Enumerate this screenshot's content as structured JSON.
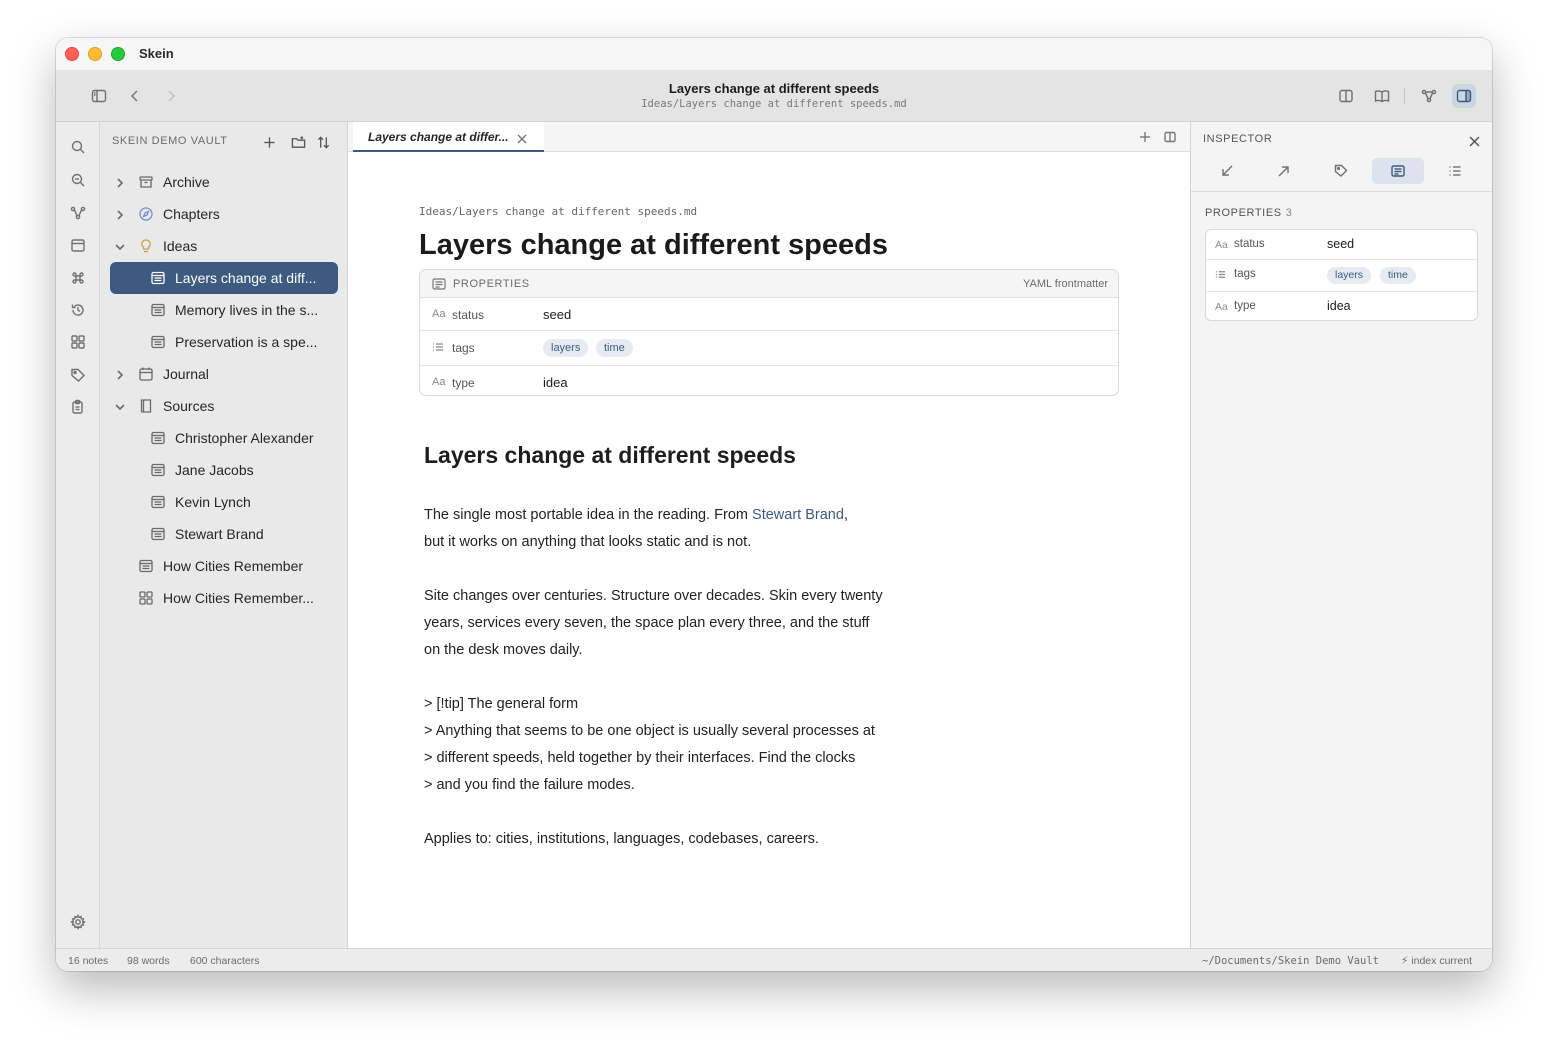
{
  "app": {
    "name": "Skein"
  },
  "toolbar": {
    "title": "Layers change at different speeds",
    "path": "Ideas/Layers change at different speeds.md"
  },
  "sidebar": {
    "vault_name": "SKEIN DEMO VAULT",
    "items": [
      {
        "label": "Archive",
        "icon": "archive-icon",
        "kind": "folder",
        "expanded": false,
        "depth": 0
      },
      {
        "label": "Chapters",
        "icon": "compass-icon",
        "kind": "folder",
        "expanded": false,
        "depth": 0
      },
      {
        "label": "Ideas",
        "icon": "lightbulb-icon",
        "kind": "folder",
        "expanded": true,
        "depth": 0
      },
      {
        "label": "Layers change at diff...",
        "icon": "note-icon",
        "kind": "note",
        "depth": 1,
        "selected": true
      },
      {
        "label": "Memory lives in the s...",
        "icon": "note-icon",
        "kind": "note",
        "depth": 1
      },
      {
        "label": "Preservation is a spe...",
        "icon": "note-icon",
        "kind": "note",
        "depth": 1
      },
      {
        "label": "Journal",
        "icon": "calendar-icon",
        "kind": "folder",
        "expanded": false,
        "depth": 0
      },
      {
        "label": "Sources",
        "icon": "book-icon",
        "kind": "folder",
        "expanded": true,
        "depth": 0
      },
      {
        "label": "Christopher Alexander",
        "icon": "note-icon",
        "kind": "note",
        "depth": 1
      },
      {
        "label": "Jane Jacobs",
        "icon": "note-icon",
        "kind": "note",
        "depth": 1
      },
      {
        "label": "Kevin Lynch",
        "icon": "note-icon",
        "kind": "note",
        "depth": 1
      },
      {
        "label": "Stewart Brand",
        "icon": "note-icon",
        "kind": "note",
        "depth": 1
      },
      {
        "label": "How Cities Remember",
        "icon": "note-icon",
        "kind": "note",
        "depth": 0
      },
      {
        "label": "How Cities Remember...",
        "icon": "grid-icon",
        "kind": "canvas",
        "depth": 0
      }
    ]
  },
  "tab": {
    "label": "Layers change at differ..."
  },
  "editor": {
    "file_path": "Ideas/Layers change at different speeds.md",
    "title": "Layers change at different speeds",
    "properties": {
      "header": "PROPERTIES",
      "source": "YAML frontmatter",
      "rows": [
        {
          "type": "Aa",
          "key": "status",
          "value": "seed"
        },
        {
          "type": "list",
          "key": "tags",
          "chips": [
            "layers",
            "time"
          ]
        },
        {
          "type": "Aa",
          "key": "type",
          "value": "idea"
        }
      ]
    },
    "heading": "Layers change at different speeds",
    "paragraphs": {
      "p1_before": "The single most portable idea in the reading. From ",
      "p1_link": "Stewart Brand",
      "p1_after": ",",
      "p1_line2": "but it works on anything that looks static and is not.",
      "p2_l1": "Site changes over centuries. Structure over decades. Skin every twenty",
      "p2_l2": "years, services every seven, the space plan every three, and the stuff",
      "p2_l3": "on the desk moves daily.",
      "q_l1": "> [!tip] The general form",
      "q_l2": "> Anything that seems to be one object is usually several processes at",
      "q_l3": "> different speeds, held together by their interfaces. Find the clocks",
      "q_l4": "> and you find the failure modes.",
      "p4": "Applies to: cities, institutions, languages, codebases, careers."
    }
  },
  "inspector": {
    "title": "INSPECTOR",
    "properties_label": "PROPERTIES",
    "properties_count": "3",
    "rows": [
      {
        "type": "Aa",
        "key": "status",
        "value": "seed"
      },
      {
        "type": "list",
        "key": "tags",
        "chips": [
          "layers",
          "time"
        ]
      },
      {
        "type": "Aa",
        "key": "type",
        "value": "idea"
      }
    ]
  },
  "status": {
    "notes": "16 notes",
    "words": "98 words",
    "chars": "600 characters",
    "vault_path": "~/Documents/Skein Demo Vault",
    "index": "index current"
  },
  "colors": {
    "accent": "#3d5a80",
    "chip_bg": "#e6ebf2"
  }
}
